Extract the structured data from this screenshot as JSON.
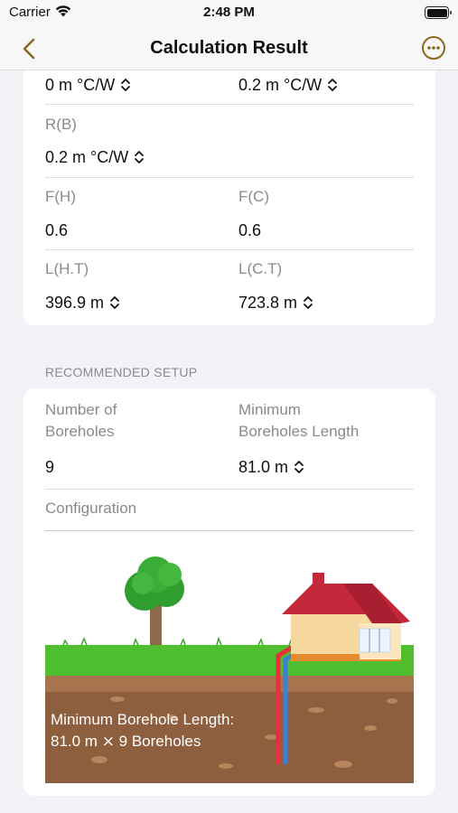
{
  "status_bar": {
    "carrier": "Carrier",
    "time": "2:48 PM"
  },
  "nav": {
    "title": "Calculation Result"
  },
  "parameters": {
    "row1": {
      "left_value": "0 m °C/W",
      "right_value": "0.2 m °C/W"
    },
    "rb": {
      "label": "R(B)",
      "value": "0.2 m °C/W"
    },
    "fh": {
      "label": "F(H)",
      "value": "0.6"
    },
    "fc": {
      "label": "F(C)",
      "value": "0.6"
    },
    "lht": {
      "label": "L(H.T)",
      "value": "396.9 m"
    },
    "lct": {
      "label": "L(C.T)",
      "value": "723.8 m"
    }
  },
  "setup": {
    "section_title": "RECOMMENDED SETUP",
    "boreholes_label_line1": "Number of",
    "boreholes_label_line2": "Boreholes",
    "boreholes_value": "9",
    "min_length_label_line1": "Minimum",
    "min_length_label_line2": "Boreholes Length",
    "min_length_value": "81.0 m",
    "configuration_label": "Configuration",
    "caption_line1": "Minimum Borehole Length:",
    "caption_line2": "81.0 m ⨯ 9 Boreholes"
  },
  "colors": {
    "accent": "#8a6a1f",
    "grass": "#4fbf2f",
    "soil": "#8e5f3e",
    "roof": "#c4283a",
    "house_wall": "#f7d9a0"
  }
}
